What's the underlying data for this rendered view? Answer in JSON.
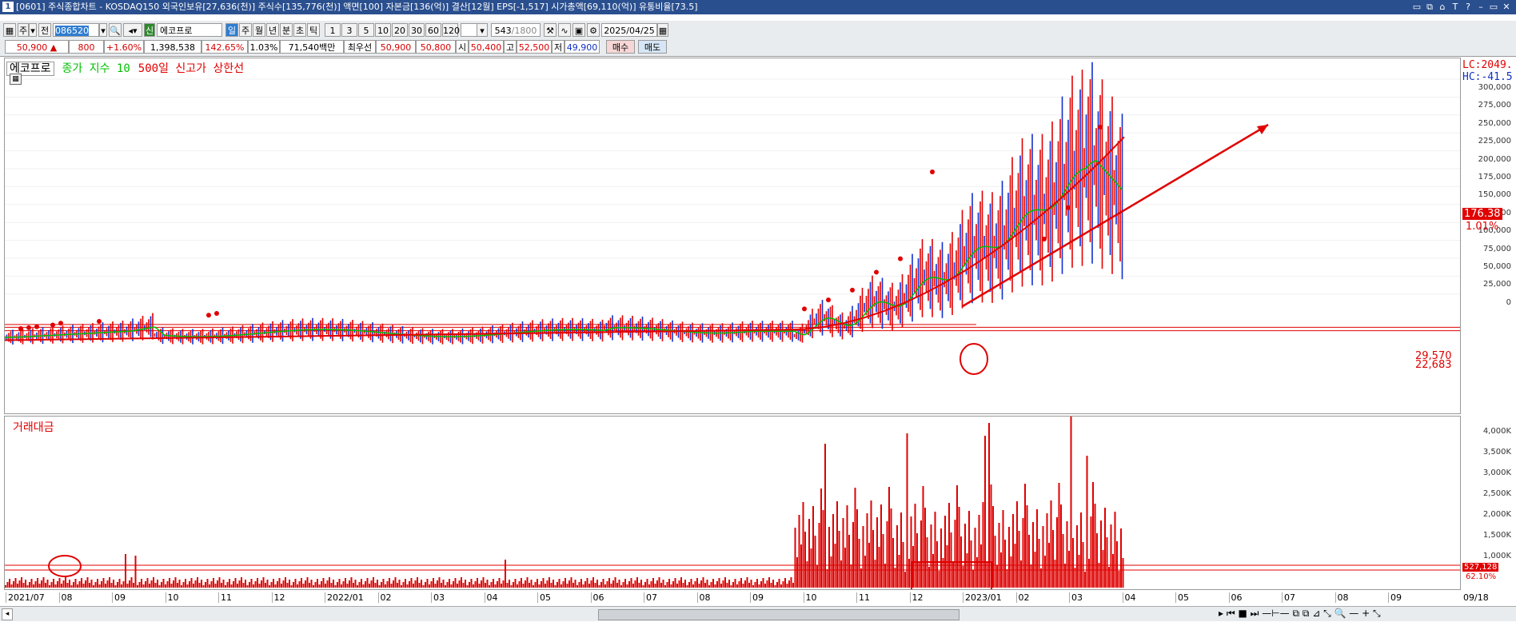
{
  "title": {
    "icon": "1",
    "text": "[0601] 주식종합차트 - KOSDAQ150 외국인보유[27,636(천)] 주식수[135,776(천)] 액면[100] 자본금[136(억)] 결산[12월] EPS[-1,517] 시가총액[69,110(억)] 유통비율[73.5]",
    "controls": [
      "▭",
      "⧉",
      "⌂",
      "T",
      "?",
      "–",
      "▭",
      "✕"
    ]
  },
  "toolbar": {
    "mode_labels": [
      "주",
      "전"
    ],
    "code": "086520",
    "name": "에코프로",
    "period_tabs": [
      "일",
      "주",
      "월",
      "년",
      "분",
      "초",
      "틱"
    ],
    "numbers": [
      "1",
      "3",
      "5",
      "10",
      "20",
      "30",
      "60",
      "120"
    ],
    "count": "543",
    "total": "/1800",
    "date": "2025/04/25"
  },
  "quote": {
    "price": "50,900",
    "arrow": "▲",
    "change": "800",
    "change_pct": "+1.60%",
    "volume": "1,398,538",
    "vol_ratio": "142.65%",
    "turnover": "1.03%",
    "amount": "71,540백만",
    "best_label": "최우선",
    "ask": "50,900",
    "bid": "50,800",
    "open_label": "시",
    "open": "50,400",
    "high_label": "고",
    "high": "52,500",
    "low_label": "저",
    "low": "49,900",
    "buy": "매수",
    "sell": "매도"
  },
  "legend": {
    "name": "에코프로",
    "ma": "종가 지수 10",
    "high": "500일 신고가 상한선"
  },
  "price_panel": {
    "lc": "LC:2049.",
    "hc": "HC:-41.5",
    "last": "176.38",
    "last_pct": "1.01%",
    "level1": "29,570",
    "level2": "22,683",
    "yticks": [
      "300,000",
      "275,000",
      "250,000",
      "225,000",
      "200,000",
      "175,000",
      "150,000",
      "125,000",
      "100,000",
      "75,000",
      "50,000",
      "25,000",
      "0"
    ]
  },
  "volume_panel": {
    "label": "거래대금",
    "yticks": [
      "4,000K",
      "3,500K",
      "3,000K",
      "2,500K",
      "2,000K",
      "1,500K",
      "1,000K"
    ],
    "last": "527,128",
    "last_pct": "62.10%"
  },
  "xaxis": {
    "ticks": [
      "2021/07",
      "08",
      "09",
      "10",
      "11",
      "12",
      "2022/01",
      "02",
      "03",
      "04",
      "05",
      "06",
      "07",
      "08",
      "09",
      "10",
      "11",
      "12",
      "2023/01",
      "02",
      "03",
      "04",
      "05",
      "06",
      "07",
      "08",
      "09"
    ],
    "right": "09/18"
  },
  "colors": {
    "up": "#e00000",
    "down": "#1030d0",
    "ma": "#00c000",
    "line": "#e00000"
  }
}
